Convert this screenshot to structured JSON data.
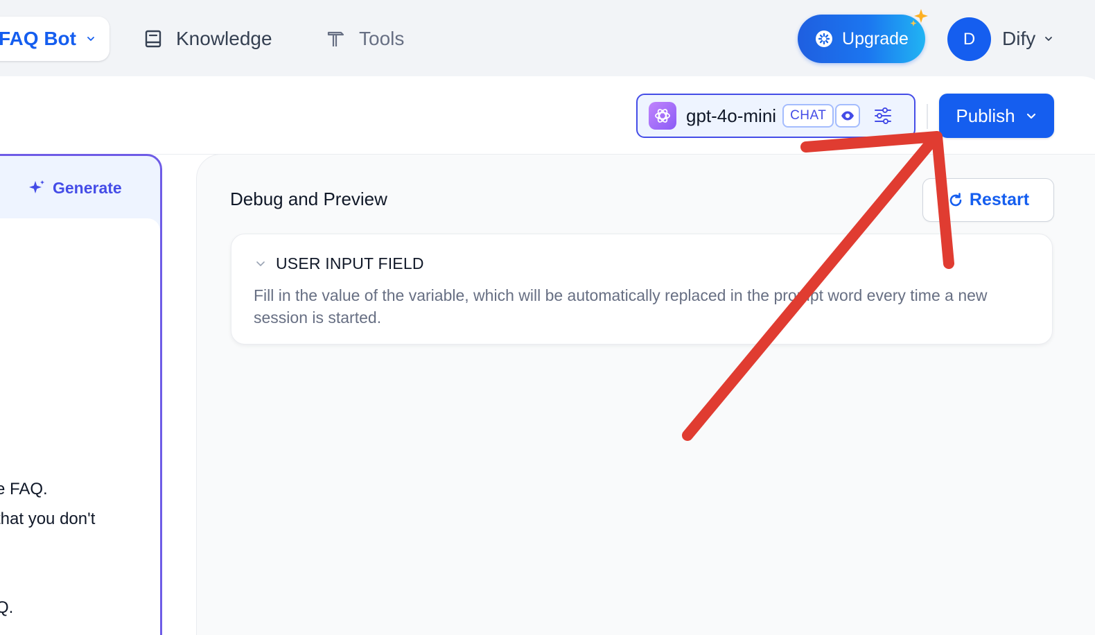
{
  "nav": {
    "app_name": "FAQ Bot",
    "knowledge_label": "Knowledge",
    "tools_label": "Tools",
    "upgrade_label": "Upgrade",
    "avatar_initial": "D",
    "workspace_name": "Dify"
  },
  "toolbar": {
    "model_name": "gpt-4o-mini",
    "model_mode_badge": "CHAT",
    "publish_label": "Publish"
  },
  "prompt_panel": {
    "generate_label": "Generate",
    "visible_lines": [
      "e FAQ.",
      " that you don't",
      "Q."
    ]
  },
  "debug": {
    "title": "Debug and Preview",
    "restart_label": "Restart",
    "user_input": {
      "heading": "USER INPUT FIELD",
      "description": "Fill in the value of the variable, which will be automatically replaced in the prompt word every time a new session is started."
    }
  },
  "colors": {
    "primary": "#155eef",
    "indigo": "#444ce7",
    "panel_border": "#6e5ce6",
    "annotation_red": "#e03c31"
  },
  "icons": {
    "knowledge": "book-icon",
    "tools": "hammer-icon",
    "upgrade": "sparkle-gear-icon",
    "model": "openai-logo-icon",
    "vision": "eye-icon",
    "params": "sliders-icon",
    "restart": "refresh-icon",
    "generate": "sparkle-icon"
  }
}
